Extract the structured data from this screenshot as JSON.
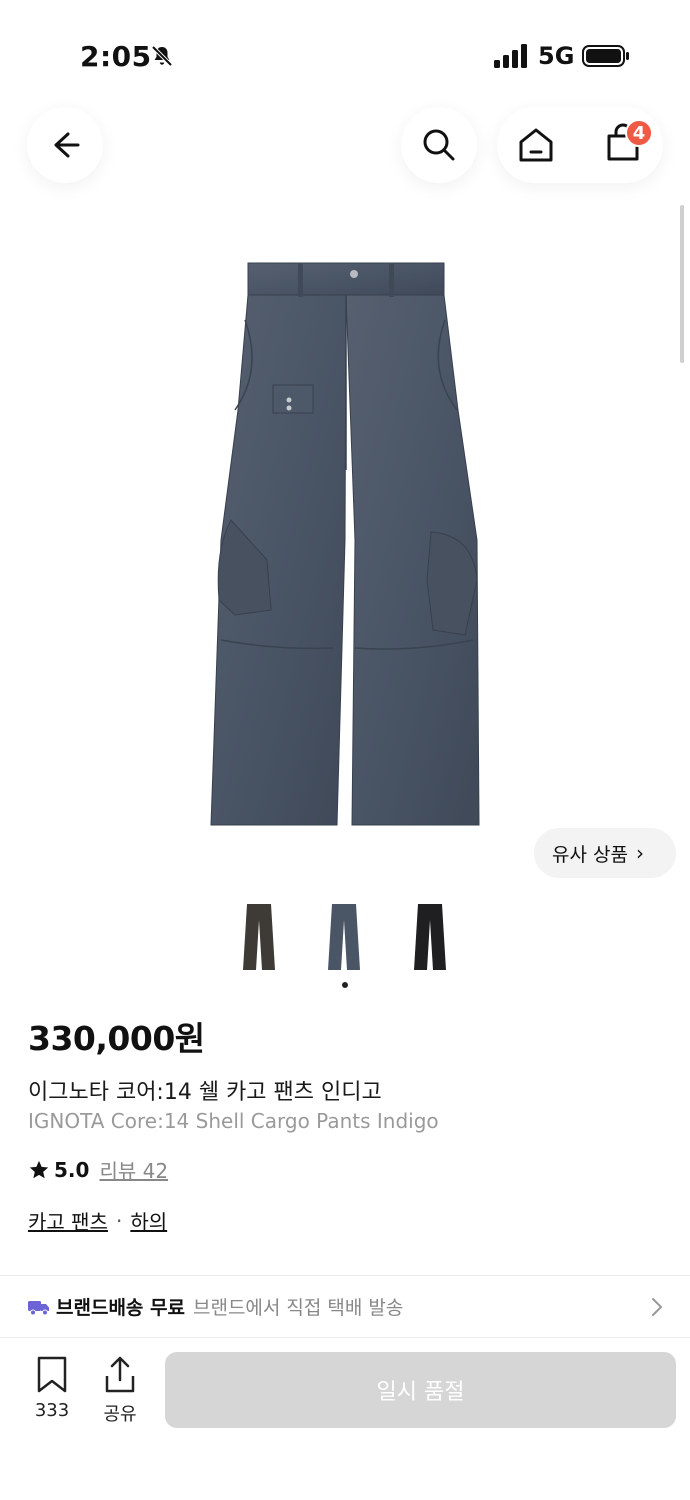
{
  "status_bar": {
    "time": "2:05",
    "network": "5G"
  },
  "header": {
    "cart_count": "4"
  },
  "similar_button": {
    "label": "유사 상품",
    "chevron": "›"
  },
  "product": {
    "price": "330,000원",
    "name_ko": "이그노타 코어:14 쉘 카고 팬츠 인디고",
    "name_en": "IGNOTA Core:14 Shell Cargo Pants Indigo",
    "rating": "5.0",
    "review_label": "리뷰 42",
    "category": "카고 팬츠",
    "category_separator": "·",
    "subcategory": "하의"
  },
  "thumbnails": [
    {
      "color": "#3e3a36"
    },
    {
      "color": "#4a5566"
    },
    {
      "color": "#1f1f22"
    }
  ],
  "shipping": {
    "title": "브랜드배송 무료",
    "desc": "브랜드에서 직접 택배 발송"
  },
  "bottom_bar": {
    "bookmark_count": "333",
    "share_label": "공유",
    "soldout_label": "일시 품절"
  },
  "colors": {
    "badge": "#ef5a45",
    "denim": "#4a5566",
    "soldout_bg": "#d6d6d6"
  }
}
